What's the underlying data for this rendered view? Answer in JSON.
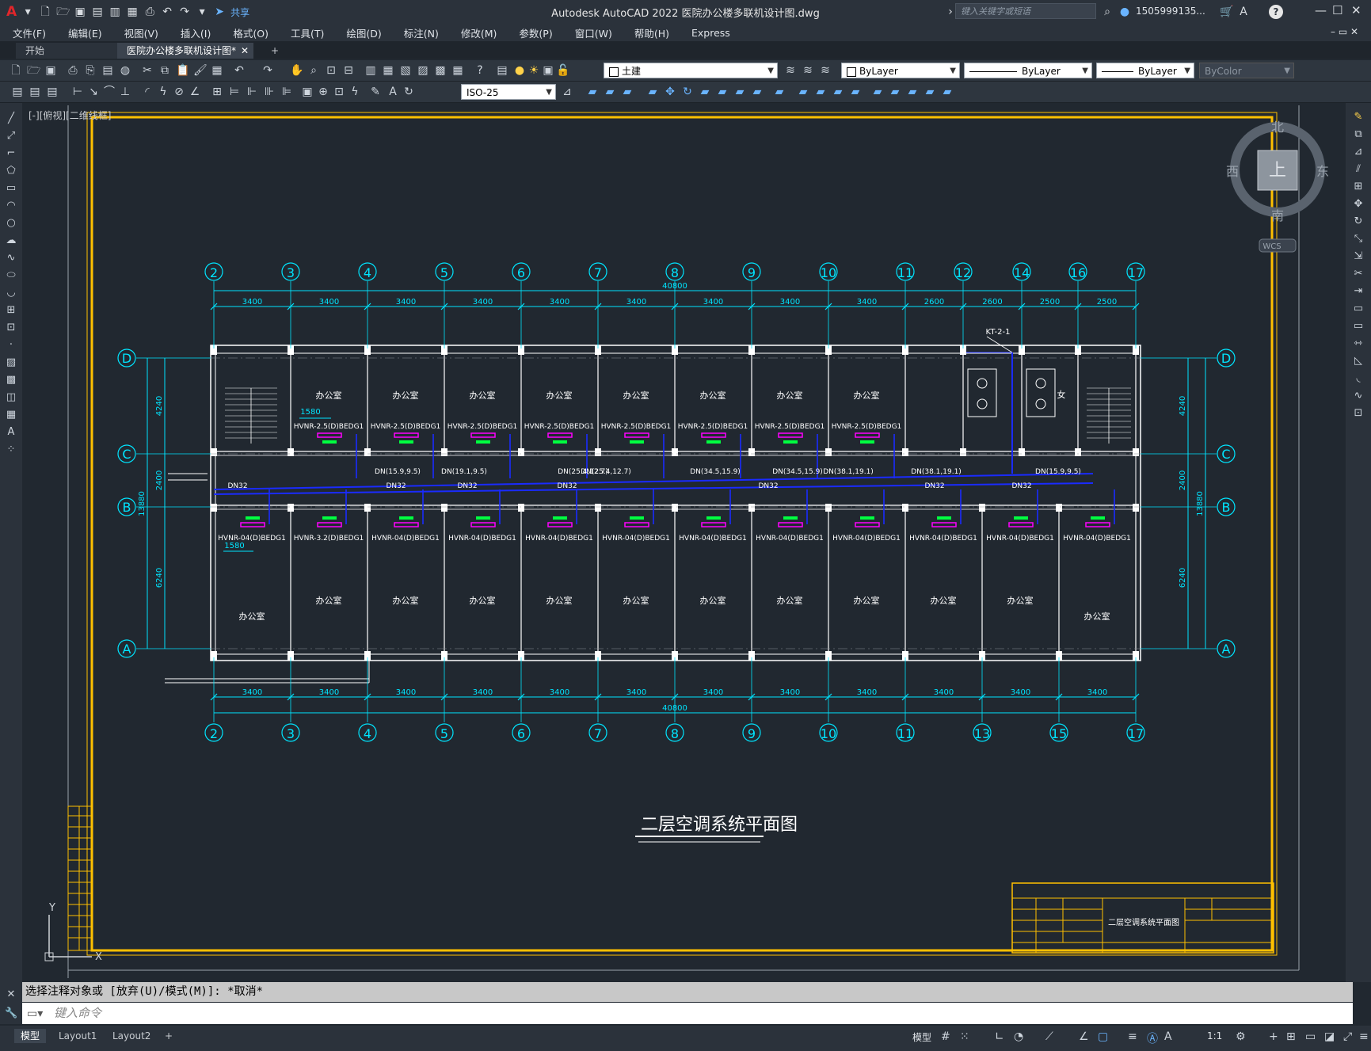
{
  "app": {
    "title": "Autodesk AutoCAD 2022    医院办公楼多联机设计图.dwg",
    "share_label": "共享",
    "search_placeholder": "键入关键字或短语",
    "user": "1505999135...",
    "help": "?"
  },
  "menus": [
    "文件(F)",
    "编辑(E)",
    "视图(V)",
    "插入(I)",
    "格式(O)",
    "工具(T)",
    "绘图(D)",
    "标注(N)",
    "修改(M)",
    "参数(P)",
    "窗口(W)",
    "帮助(H)",
    "Express"
  ],
  "tabs": {
    "start": "开始",
    "drawing": "医院办公楼多联机设计图*",
    "add": "+"
  },
  "toolbar": {
    "layer": "土建",
    "color": "ByLayer",
    "linetype": "ByLayer",
    "lineweight": "ByLayer",
    "plotstyle": "ByColor",
    "dimstyle": "ISO-25"
  },
  "viewport_label": "[-][俯视][二维线框]",
  "viewcube": {
    "north": "北",
    "south": "南",
    "east": "东",
    "west": "西",
    "top": "上",
    "wcs": "WCS"
  },
  "drawing": {
    "title": "二层空调系统平面图",
    "top_axes": [
      "2",
      "3",
      "4",
      "5",
      "6",
      "7",
      "8",
      "9",
      "10",
      "11",
      "12",
      "14",
      "16",
      "17"
    ],
    "bottom_axes": [
      "2",
      "3",
      "4",
      "5",
      "6",
      "7",
      "8",
      "9",
      "10",
      "11",
      "13",
      "15",
      "17"
    ],
    "row_axes": [
      "D",
      "C",
      "B",
      "A"
    ],
    "top_dims": [
      "3400",
      "3400",
      "3400",
      "3400",
      "3400",
      "3400",
      "3400",
      "3400",
      "3400",
      "2600",
      "2600",
      "2500",
      "2500"
    ],
    "bottom_dims": [
      "3400",
      "3400",
      "3400",
      "3400",
      "3400",
      "3400",
      "3400",
      "3400",
      "3400",
      "3400",
      "3400",
      "3400"
    ],
    "overall_width": "40800",
    "row_dims": [
      "4240",
      "2400",
      "6240"
    ],
    "overall_depth": "13880",
    "room_label": "办公室",
    "top_units": [
      "HVNR-2.5(D)BEDG1",
      "HVNR-2.5(D)BEDG1",
      "HVNR-2.5(D)BEDG1",
      "HVNR-2.5(D)BEDG1",
      "HVNR-2.5(D)BEDG1",
      "HVNR-2.5(D)BEDG1",
      "HVNR-2.5(D)BEDG1",
      "HVNR-2.5(D)BEDG1"
    ],
    "bottom_units": [
      "HVNR-04(D)BEDG1",
      "HVNR-3.2(D)BEDG1",
      "HVNR-04(D)BEDG1",
      "HVNR-04(D)BEDG1",
      "HVNR-04(D)BEDG1",
      "HVNR-04(D)BEDG1",
      "HVNR-04(D)BEDG1",
      "HVNR-04(D)BEDG1",
      "HVNR-04(D)BEDG1",
      "HVNR-04(D)BEDG1",
      "HVNR-04(D)BEDG1",
      "HVNR-04(D)BEDG1"
    ],
    "pipe_labels": [
      "DN(15.9,9.5)",
      "DN(19.1,9.5)",
      "DN(25.4,12.7)",
      "DN(25.4,12.7)",
      "DN(34.5,15.9)",
      "DN(34.5,15.9)",
      "DN(38.1,19.1)",
      "DN(38.1,19.1)",
      "DN(15.9,9.5)"
    ],
    "drain_labels": [
      "DN32",
      "DN32",
      "DN32",
      "DN32",
      "DN32",
      "DN32",
      "DN32"
    ],
    "dim_1580": "1580",
    "riser_label": "KT-2-1",
    "female_label": "女",
    "titleblock_name": "二层空调系统平面图"
  },
  "command": {
    "history": "选择注释对象或 [放弃(U)/模式(M)]: *取消*",
    "placeholder": "键入命令"
  },
  "layouts": [
    "模型",
    "Layout1",
    "Layout2"
  ],
  "status": {
    "model_label": "模型",
    "scale": "1:1"
  },
  "colors": {
    "cyan": "#00e5ff",
    "white": "#ffffff",
    "yellow": "#ffc000",
    "blue": "#1a2bff",
    "magenta": "#ff00ff",
    "green": "#00ff40"
  }
}
